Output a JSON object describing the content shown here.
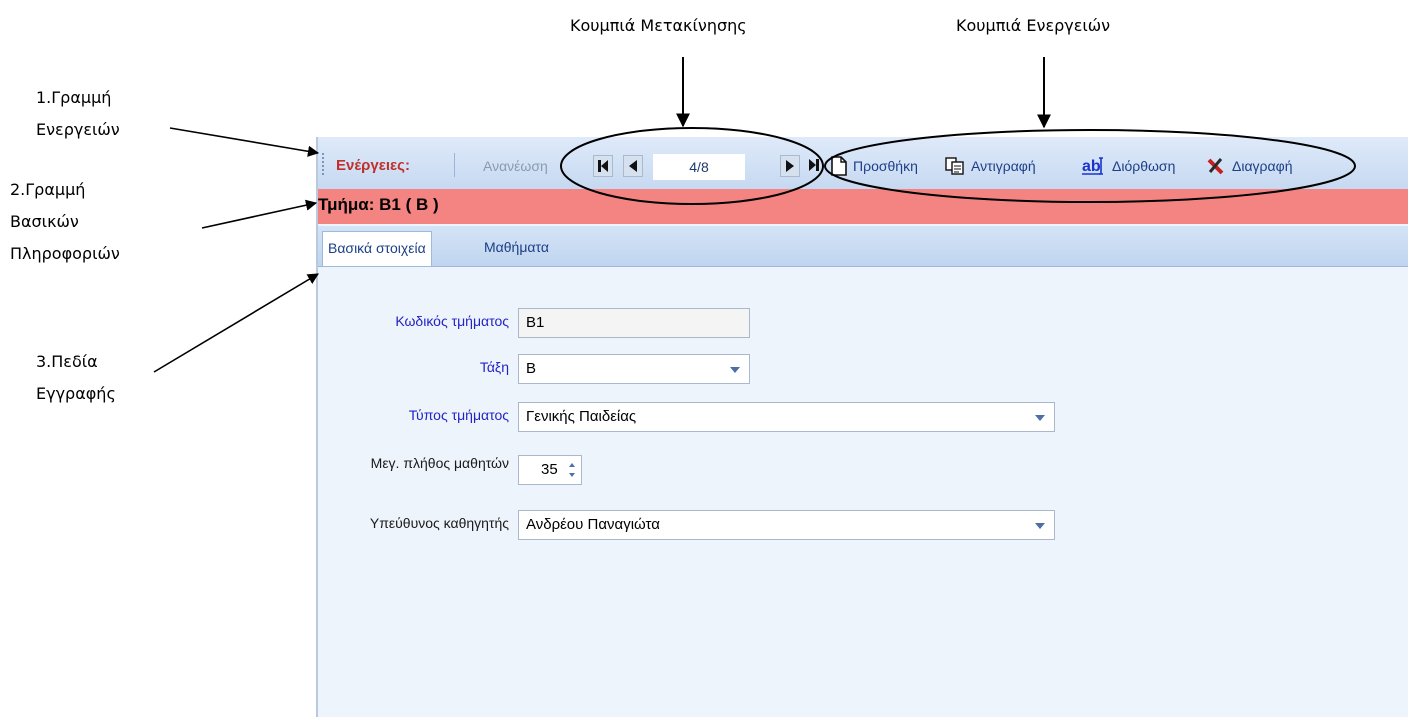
{
  "annotations": {
    "top_navigation_label": "Κουμπιά Μετακίνησης",
    "top_actions_label": "Κουμπιά Ενεργειών",
    "left1": [
      "1.Γραμμή",
      "Ενεργειών"
    ],
    "left2": [
      "2.Γραμμή",
      "Βασικών",
      "Πληροφοριών"
    ],
    "left3": [
      "3.Πεδία",
      "Εγγραφής"
    ]
  },
  "toolbar": {
    "title": "Ενέργειες:",
    "refresh_label": "Ανανέωση",
    "nav_position": "4/8",
    "add_label": "Προσθήκη",
    "copy_label": "Αντιγραφή",
    "edit_label": "Διόρθωση",
    "delete_label": "Διαγραφή"
  },
  "info_bar": {
    "title": "Τμήμα: Β1 ( Β )"
  },
  "tabs": [
    {
      "label": "Βασικά στοιχεία",
      "active": true
    },
    {
      "label": "Μαθήματα",
      "active": false
    }
  ],
  "form": {
    "code": {
      "label": "Κωδικός τμήματος",
      "value": "Β1"
    },
    "grade": {
      "label": "Τάξη",
      "value": "Β"
    },
    "type": {
      "label": "Τύπος τμήματος",
      "value": "Γενικής Παιδείας"
    },
    "max_students": {
      "label": "Μεγ. πλήθος μαθητών",
      "value": "35"
    },
    "teacher": {
      "label": "Υπεύθυνος καθηγητής",
      "value": "Ανδρέου Παναγιώτα"
    }
  },
  "colors": {
    "toolbar_title": "#c0302a",
    "info_bar": "#f48481",
    "label_blue": "#2323c8",
    "tab_text": "#1c3f86"
  }
}
